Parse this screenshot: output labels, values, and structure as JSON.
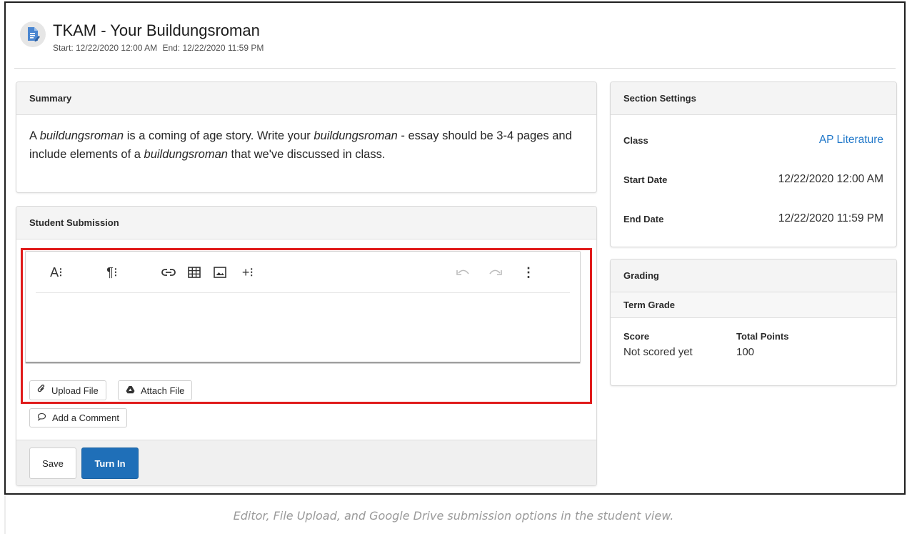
{
  "header": {
    "title": "TKAM - Your Buildungsroman",
    "start_text": "Start: 12/22/2020 12:00 AM",
    "end_text": "End: 12/22/2020 11:59 PM"
  },
  "summary": {
    "heading": "Summary",
    "t1": "A ",
    "t2": "buildungsroman",
    "t3": " is a coming of age story. Write your ",
    "t4": "buildungsroman",
    "t5": " - essay should be 3-4 pages and include elements of a ",
    "t6": "buildungsroman",
    "t7": " that we've discussed in class."
  },
  "submission": {
    "heading": "Student Submission",
    "toolbar": {
      "font_label": "A⁝",
      "paragraph_label": "¶⁝",
      "insert_label": "+⁝",
      "more_label": "⋮",
      "icons": [
        "font-icon",
        "paragraph-icon",
        "link-icon",
        "table-icon",
        "image-icon",
        "insert-icon",
        "undo-icon",
        "redo-icon",
        "more-icon"
      ]
    },
    "upload_label": "Upload File",
    "attach_label": "Attach File",
    "comment_label": "Add a Comment",
    "save_label": "Save",
    "turn_in_label": "Turn In"
  },
  "settings": {
    "heading": "Section Settings",
    "class_label": "Class",
    "class_value": "AP Literature",
    "start_label": "Start Date",
    "start_value": "12/22/2020 12:00 AM",
    "end_label": "End Date",
    "end_value": "12/22/2020 11:59 PM"
  },
  "grading": {
    "heading": "Grading",
    "term": "Term Grade",
    "score_label": "Score",
    "score_value": "Not scored yet",
    "points_label": "Total Points",
    "points_value": "100"
  },
  "colors": {
    "accent": "#1f6fb8",
    "link": "#1f77c9",
    "highlight": "#e01b1b"
  },
  "caption": "Editor, File Upload, and Google Drive submission options in the student view."
}
